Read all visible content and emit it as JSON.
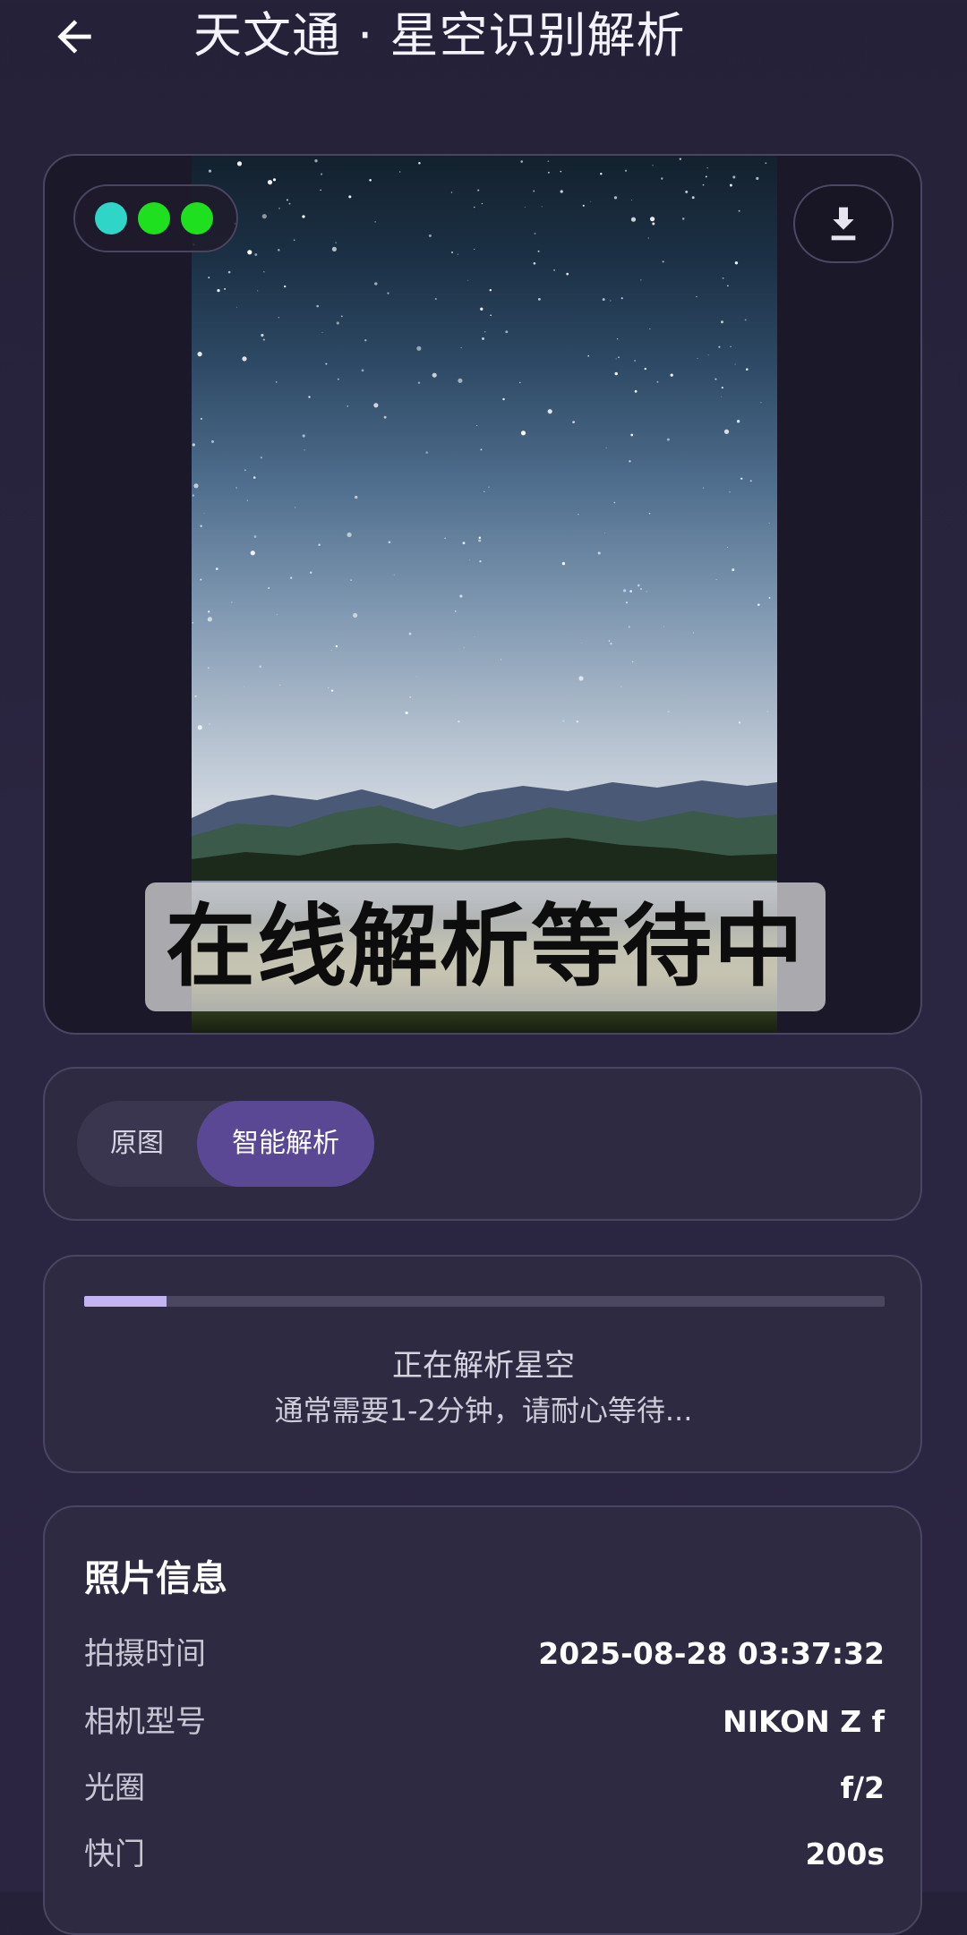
{
  "header": {
    "title": "天文通 · 星空识别解析",
    "back_icon": "arrow-left-icon"
  },
  "image_card": {
    "overlay_text": "在线解析等待中",
    "status_dots": [
      {
        "color": "#2fd6c8"
      },
      {
        "color": "#1fe01f"
      },
      {
        "color": "#1fe01f"
      }
    ],
    "download_icon": "download-icon"
  },
  "view_toggle": {
    "options": [
      {
        "label": "原图",
        "selected": false
      },
      {
        "label": "智能解析",
        "selected": true
      }
    ]
  },
  "progress": {
    "fraction": 0.103,
    "title": "正在解析星空",
    "subtitle": "通常需要1-2分钟，请耐心等待..."
  },
  "photo_info": {
    "title": "照片信息",
    "rows": [
      {
        "label": "拍摄时间",
        "value": "2025-08-28 03:37:32"
      },
      {
        "label": "相机型号",
        "value": "NIKON Z f"
      },
      {
        "label": "光圈",
        "value": "f/2"
      },
      {
        "label": "快门",
        "value": "200s"
      }
    ]
  },
  "colors": {
    "accent": "#5a4894",
    "progress_fill": "#c4b3f2",
    "background": "#2a2540"
  }
}
